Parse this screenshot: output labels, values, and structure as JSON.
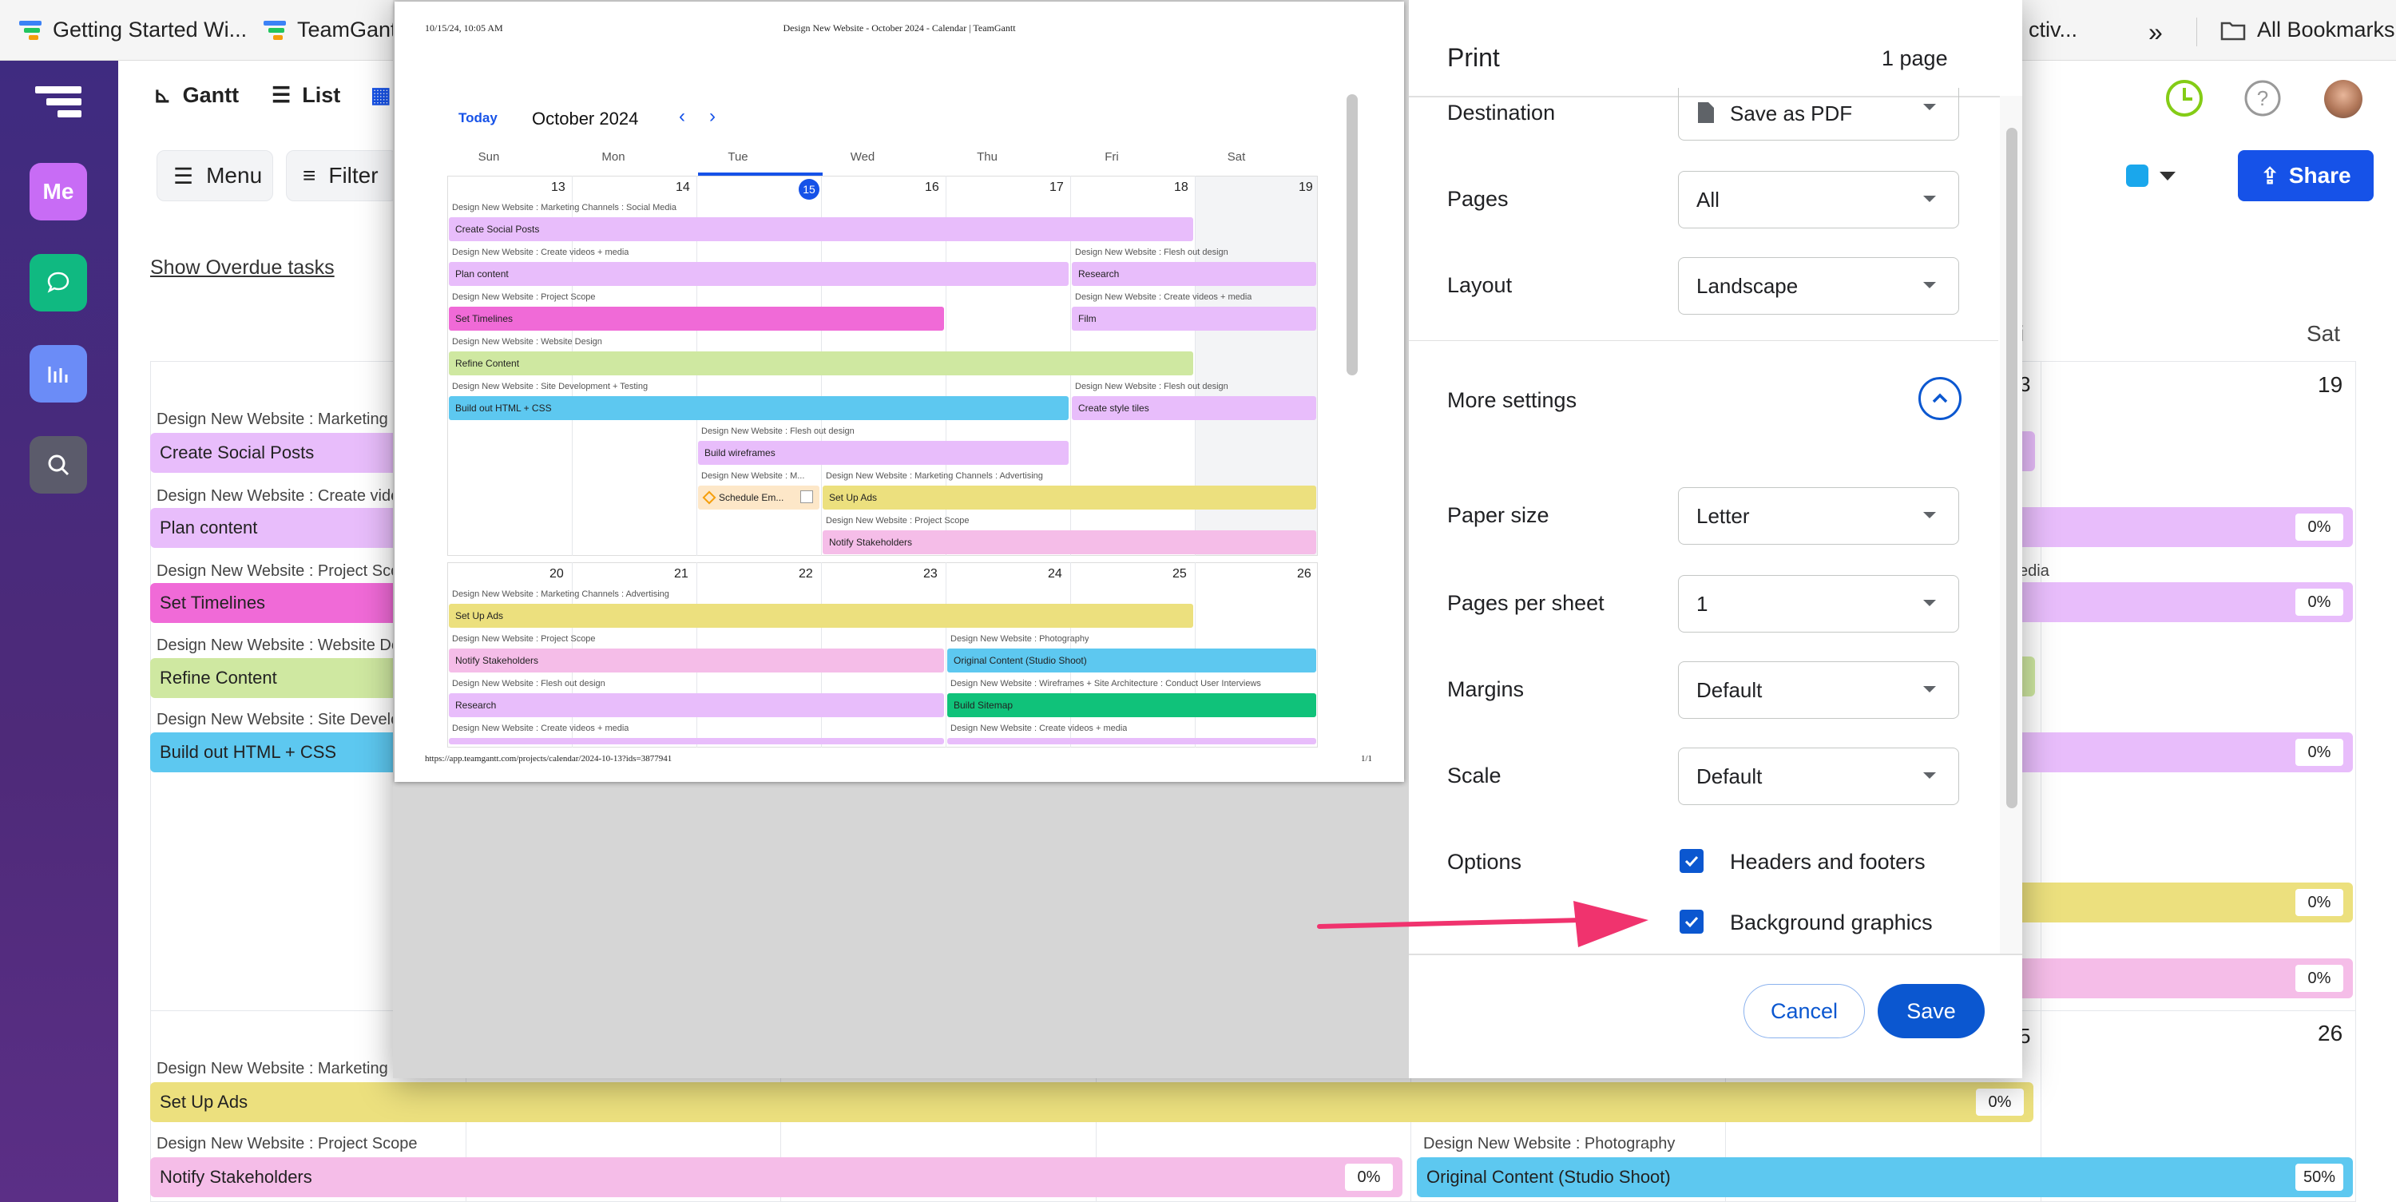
{
  "bookmarks": {
    "items": [
      "Getting Started Wi...",
      "TeamGant",
      "ctiv..."
    ],
    "more": "»",
    "all_bookmarks": "All Bookmarks"
  },
  "sidebar": {
    "me": "Me"
  },
  "app": {
    "nav": {
      "gantt": "Gantt",
      "list": "List"
    },
    "menu_label": "Menu",
    "filter_label": "Filter",
    "share_label": "Share",
    "overdue_link": "Show Overdue tasks",
    "color_accent": "#1652e8"
  },
  "calendar": {
    "header_sat": "Sat",
    "header_partial": "i",
    "day19": "19",
    "day26": "26",
    "day_partial_a": "3",
    "day_partial_b": "5",
    "media_partial": "edia",
    "rows": [
      {
        "label": "Design New Website : Marketing C",
        "bar": "Create Social Posts",
        "color": "#e8bdfb"
      },
      {
        "label": "Design New Website : Create vide",
        "bar": "Plan content",
        "color": "#e8bdfb"
      },
      {
        "label": "Design New Website : Project Sco",
        "bar": "Set Timelines",
        "color": "#f06ad7"
      },
      {
        "label": "Design New Website : Website De",
        "bar": "Refine Content",
        "color": "#cfe8a1"
      },
      {
        "label": "Design New Website : Site Develo",
        "bar": "Build out HTML + CSS",
        "color": "#5dc8f0"
      }
    ],
    "right_pcts": [
      "0%",
      "0%",
      "0%",
      "0%",
      "0%"
    ],
    "week2": {
      "ads_label": "Design New Website : Marketing C",
      "ads_bar": "Set Up Ads",
      "ads_pct": "0%",
      "notify_label": "Design New Website : Project Scope",
      "notify_bar": "Notify Stakeholders",
      "notify_pct": "0%",
      "photo_label": "Design New Website : Photography",
      "photo_bar": "Original Content (Studio Shoot)",
      "photo_pct": "50%"
    }
  },
  "print": {
    "title": "Print",
    "pages_count": "1 page",
    "destination": {
      "label": "Destination",
      "value": "Save as PDF"
    },
    "pages": {
      "label": "Pages",
      "value": "All"
    },
    "layout": {
      "label": "Layout",
      "value": "Landscape"
    },
    "more_settings": "More settings",
    "paper_size": {
      "label": "Paper size",
      "value": "Letter"
    },
    "pages_per_sheet": {
      "label": "Pages per sheet",
      "value": "1"
    },
    "margins": {
      "label": "Margins",
      "value": "Default"
    },
    "scale": {
      "label": "Scale",
      "value": "Default"
    },
    "options": {
      "label": "Options",
      "headers_footers": "Headers and footers",
      "background_graphics": "Background graphics"
    },
    "cancel": "Cancel",
    "save": "Save"
  },
  "preview": {
    "timestamp": "10/15/24, 10:05 AM",
    "doc_title": "Design New Website - October 2024 - Calendar | TeamGantt",
    "today": "Today",
    "month": "October 2024",
    "weekdays": [
      "Sun",
      "Mon",
      "Tue",
      "Wed",
      "Thu",
      "Fri",
      "Sat"
    ],
    "week1_days": [
      "13",
      "14",
      "15",
      "16",
      "17",
      "18",
      "19"
    ],
    "week2_days": [
      "20",
      "21",
      "22",
      "23",
      "24",
      "25",
      "26"
    ],
    "footer_url": "https://app.teamgantt.com/projects/calendar/2024-10-13?ids=3877941",
    "page_num": "1/1",
    "w1": {
      "l1": "Design New Website : Marketing Channels : Social Media",
      "b1": "Create Social Posts",
      "l2": "Design New Website : Create videos + media",
      "b2": "Plan content",
      "l2r": "Design New Website : Flesh out design",
      "b2r": "Research",
      "l3": "Design New Website : Project Scope",
      "b3": "Set Timelines",
      "l3r": "Design New Website : Create videos + media",
      "b3r": "Film",
      "l4": "Design New Website : Website Design",
      "b4": "Refine Content",
      "l5": "Design New Website : Site Development + Testing",
      "b5": "Build out HTML + CSS",
      "l5r": "Design New Website : Flesh out design",
      "b5r": "Create style tiles",
      "l6": "Design New Website : Flesh out design",
      "b6": "Build wireframes",
      "l7a": "Design New Website : M...",
      "b7a": "Schedule Em...",
      "l7b": "Design New Website : Marketing Channels : Advertising",
      "b7b": "Set Up Ads",
      "l8": "Design New Website : Project Scope",
      "b8": "Notify Stakeholders"
    },
    "w2": {
      "l1": "Design New Website : Marketing Channels : Advertising",
      "b1": "Set Up Ads",
      "l2": "Design New Website : Project Scope",
      "b2": "Notify Stakeholders",
      "l2r": "Design New Website : Photography",
      "b2r": "Original Content (Studio Shoot)",
      "l3": "Design New Website : Flesh out design",
      "b3": "Research",
      "l3r": "Design New Website : Wireframes + Site Architecture : Conduct User Interviews",
      "b3r": "Build Sitemap",
      "l4": "Design New Website : Create videos + media",
      "l4r": "Design New Website : Create videos + media"
    }
  }
}
